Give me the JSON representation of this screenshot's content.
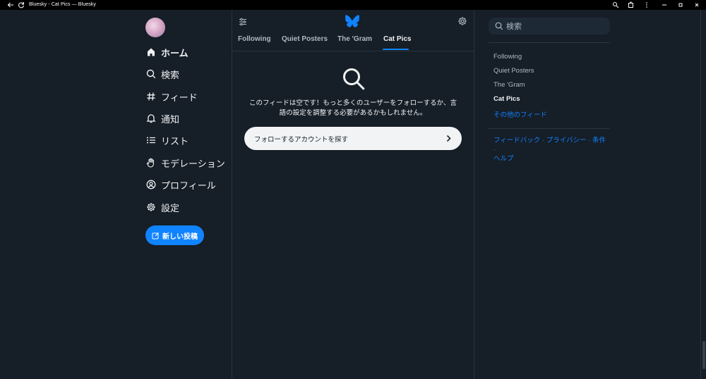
{
  "window": {
    "title": "Bluesky - Cat Pics — Bluesky"
  },
  "icons": {
    "titlebar": [
      "back-arrow-icon",
      "reload-icon",
      "zoom-icon",
      "extensions-icon",
      "more-icon",
      "minimize-icon",
      "maximize-icon",
      "close-icon"
    ],
    "nav": [
      "home-icon",
      "search-icon",
      "hash-icon",
      "bell-icon",
      "list-icon",
      "hand-icon",
      "profile-icon",
      "gear-icon"
    ],
    "header": [
      "feed-settings-icon",
      "bluesky-butterfly-logo",
      "gear-icon"
    ]
  },
  "colors": {
    "accent": "#1083fe",
    "background": "#161e27",
    "text": "#f1f3f5",
    "muted": "#aeb8c3"
  },
  "nav": {
    "items": [
      {
        "label": "ホーム",
        "active": true
      },
      {
        "label": "検索"
      },
      {
        "label": "フィード"
      },
      {
        "label": "通知"
      },
      {
        "label": "リスト"
      },
      {
        "label": "モデレーション"
      },
      {
        "label": "プロフィール"
      },
      {
        "label": "設定"
      }
    ],
    "new_post": "新しい投稿"
  },
  "feed_tabs": {
    "tabs": [
      "Following",
      "Quiet Posters",
      "The 'Gram",
      "Cat Pics"
    ],
    "active": "Cat Pics"
  },
  "empty_state": {
    "line1": "このフィードは空です！もっと多くのユーザーをフォローするか、言",
    "line2": "語の設定を調整する必要があるかもしれません。",
    "button": "フォローするアカウントを探す"
  },
  "right": {
    "search_placeholder": "検索",
    "feeds": [
      "Following",
      "Quiet Posters",
      "The 'Gram",
      "Cat Pics"
    ],
    "more_feeds": "その他のフィード",
    "footer_line1": "フィードバック · プライバシー · 条件 ·",
    "footer_line2": "ヘルプ"
  }
}
